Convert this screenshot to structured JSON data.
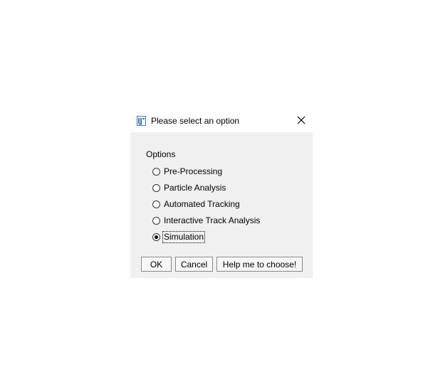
{
  "dialog": {
    "title": "Please select an option",
    "app_icon": "imagej-icon",
    "close_icon": "close-icon"
  },
  "options": {
    "group_label": "Options",
    "items": [
      {
        "label": "Pre-Processing",
        "checked": false
      },
      {
        "label": "Particle Analysis",
        "checked": false
      },
      {
        "label": "Automated Tracking",
        "checked": false
      },
      {
        "label": "Interactive Track Analysis",
        "checked": false
      },
      {
        "label": "Simulation",
        "checked": true
      }
    ]
  },
  "buttons": {
    "ok_label": "OK",
    "cancel_label": "Cancel",
    "help_label": "Help me to choose!"
  }
}
